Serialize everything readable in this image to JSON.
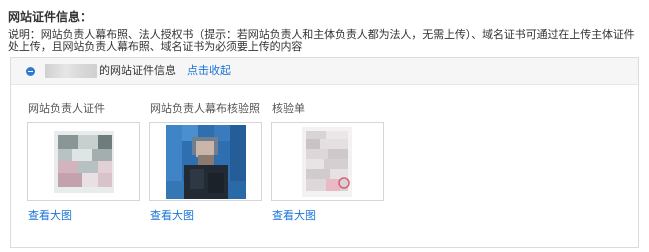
{
  "section": {
    "title": "网站证件信息：",
    "description": "说明：网站负责人幕布照、法人授权书（提示：若网站负责人和主体负责人都为法人，无需上传）、域名证书可通过在上传主体证件处上传，且网站负责人幕布照、域名证书为必须要上传的内容"
  },
  "panel": {
    "header_text": "的网站证件信息",
    "collapse_link": "点击收起"
  },
  "documents": [
    {
      "label": "网站负责人证件",
      "view_link": "查看大图"
    },
    {
      "label": "网站负责人幕布核验照",
      "view_link": "查看大图"
    },
    {
      "label": "核验单",
      "view_link": "查看大图"
    }
  ],
  "colors": {
    "link": "#1a73d9",
    "icon": "#2e7bd6"
  }
}
